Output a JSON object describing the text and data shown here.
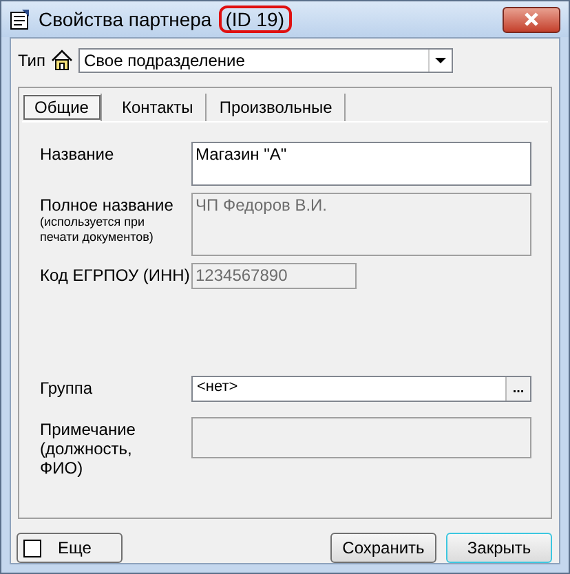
{
  "window": {
    "title": "Свойства партнера",
    "title_highlight": "(ID 19)"
  },
  "type": {
    "label": "Тип",
    "value": "Свое подразделение"
  },
  "tabs": [
    {
      "label": "Общие",
      "selected": true
    },
    {
      "label": "Контакты",
      "selected": false
    },
    {
      "label": "Произвольные",
      "selected": false
    }
  ],
  "fields": [
    {
      "kind": "area",
      "label": "Название",
      "value": "Магазин \"А\"",
      "disabled": false
    },
    {
      "kind": "area",
      "label": "Полное название",
      "hint": "(используется при печати документов)",
      "value": "ЧП Федоров В.И.",
      "disabled": true
    },
    {
      "kind": "short",
      "label": "Код ЕГРПОУ (ИНН)",
      "value": "1234567890",
      "disabled": true
    },
    {
      "kind": "spacer"
    },
    {
      "kind": "picker",
      "label": "Группа",
      "value": "<нет>",
      "button": "...",
      "disabled": false
    },
    {
      "kind": "note",
      "label": "Примечание (должность, ФИО)",
      "disabled": true
    }
  ],
  "more": {
    "label": "Еще",
    "checked": false
  },
  "buttons": [
    {
      "label": "Сохранить",
      "default": false
    },
    {
      "label": "Закрыть",
      "default": true
    }
  ]
}
